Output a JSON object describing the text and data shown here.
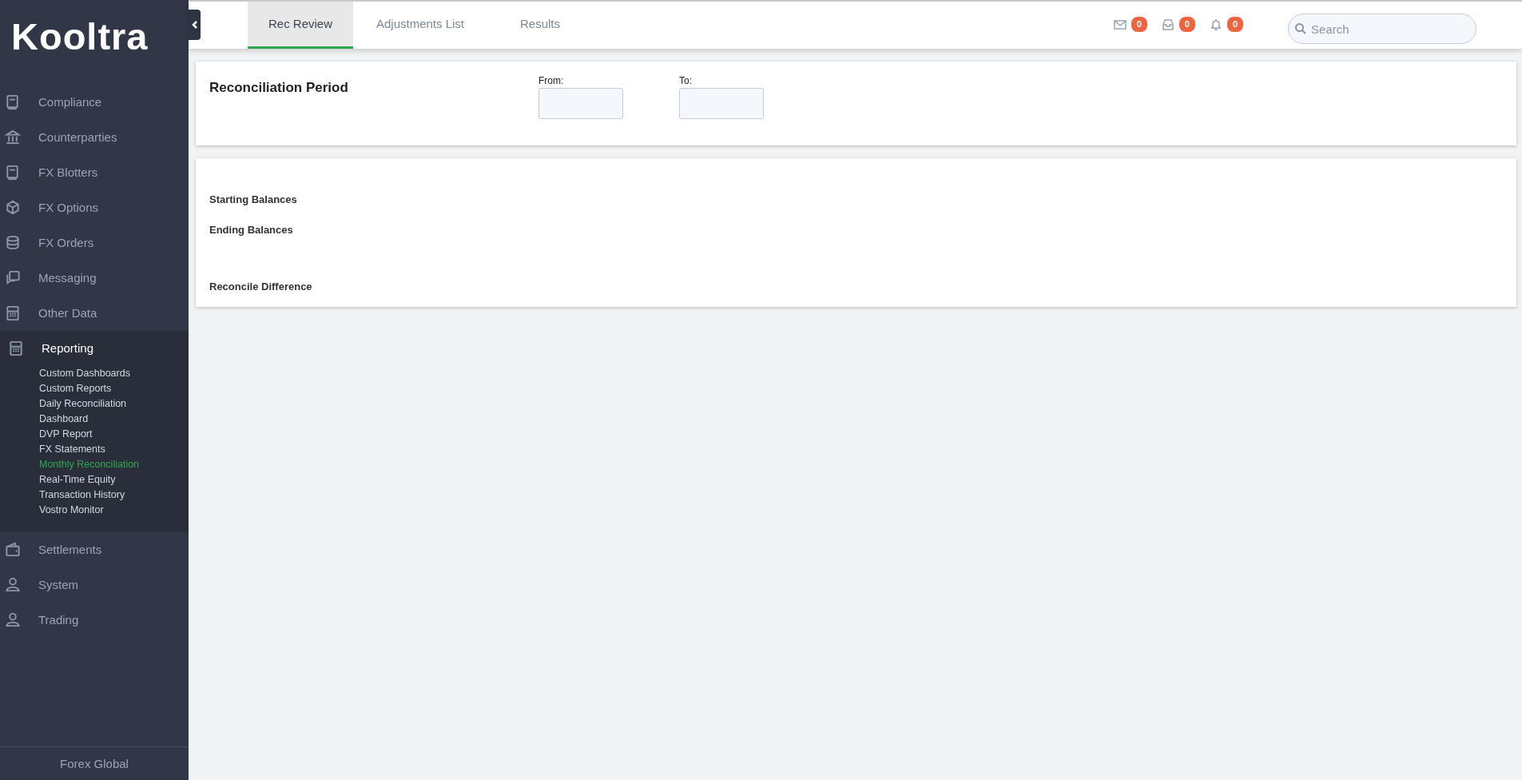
{
  "sidebar": {
    "logo": "Kooltra",
    "items": [
      {
        "label": "Compliance",
        "expanded": false
      },
      {
        "label": "Counterparties",
        "expanded": false
      },
      {
        "label": "FX Blotters",
        "expanded": false
      },
      {
        "label": "FX Options",
        "expanded": false
      },
      {
        "label": "FX Orders",
        "expanded": false
      },
      {
        "label": "Messaging",
        "expanded": false
      },
      {
        "label": "Other Data",
        "expanded": false
      },
      {
        "label": "Reporting",
        "expanded": true,
        "children": [
          {
            "label": "Custom Dashboards",
            "selected": false
          },
          {
            "label": "Custom Reports",
            "selected": false
          },
          {
            "label": "Daily Reconciliation",
            "selected": false
          },
          {
            "label": "Dashboard",
            "selected": false
          },
          {
            "label": "DVP Report",
            "selected": false
          },
          {
            "label": "FX Statements",
            "selected": false
          },
          {
            "label": "Monthly Reconciliation",
            "selected": true
          },
          {
            "label": "Real-Time Equity",
            "selected": false
          },
          {
            "label": "Transaction History",
            "selected": false
          },
          {
            "label": "Vostro Monitor",
            "selected": false
          }
        ]
      },
      {
        "label": "Settlements",
        "expanded": false
      },
      {
        "label": "System",
        "expanded": false
      },
      {
        "label": "Trading",
        "expanded": false
      }
    ],
    "footer": "Forex Global"
  },
  "tabs": [
    {
      "label": "Rec Review",
      "selected": true
    },
    {
      "label": "Adjustments List",
      "selected": false
    },
    {
      "label": "Results",
      "selected": false
    }
  ],
  "notifications": [
    {
      "count": "0"
    },
    {
      "count": "0"
    },
    {
      "count": "0"
    }
  ],
  "search": {
    "placeholder": "Search"
  },
  "period_card": {
    "title": "Reconciliation Period",
    "fields": [
      {
        "label": "From:"
      },
      {
        "label": "To:"
      }
    ]
  },
  "balances_card": {
    "rows": [
      "Starting Balances",
      "Ending Balances",
      "Reconcile Difference"
    ]
  }
}
